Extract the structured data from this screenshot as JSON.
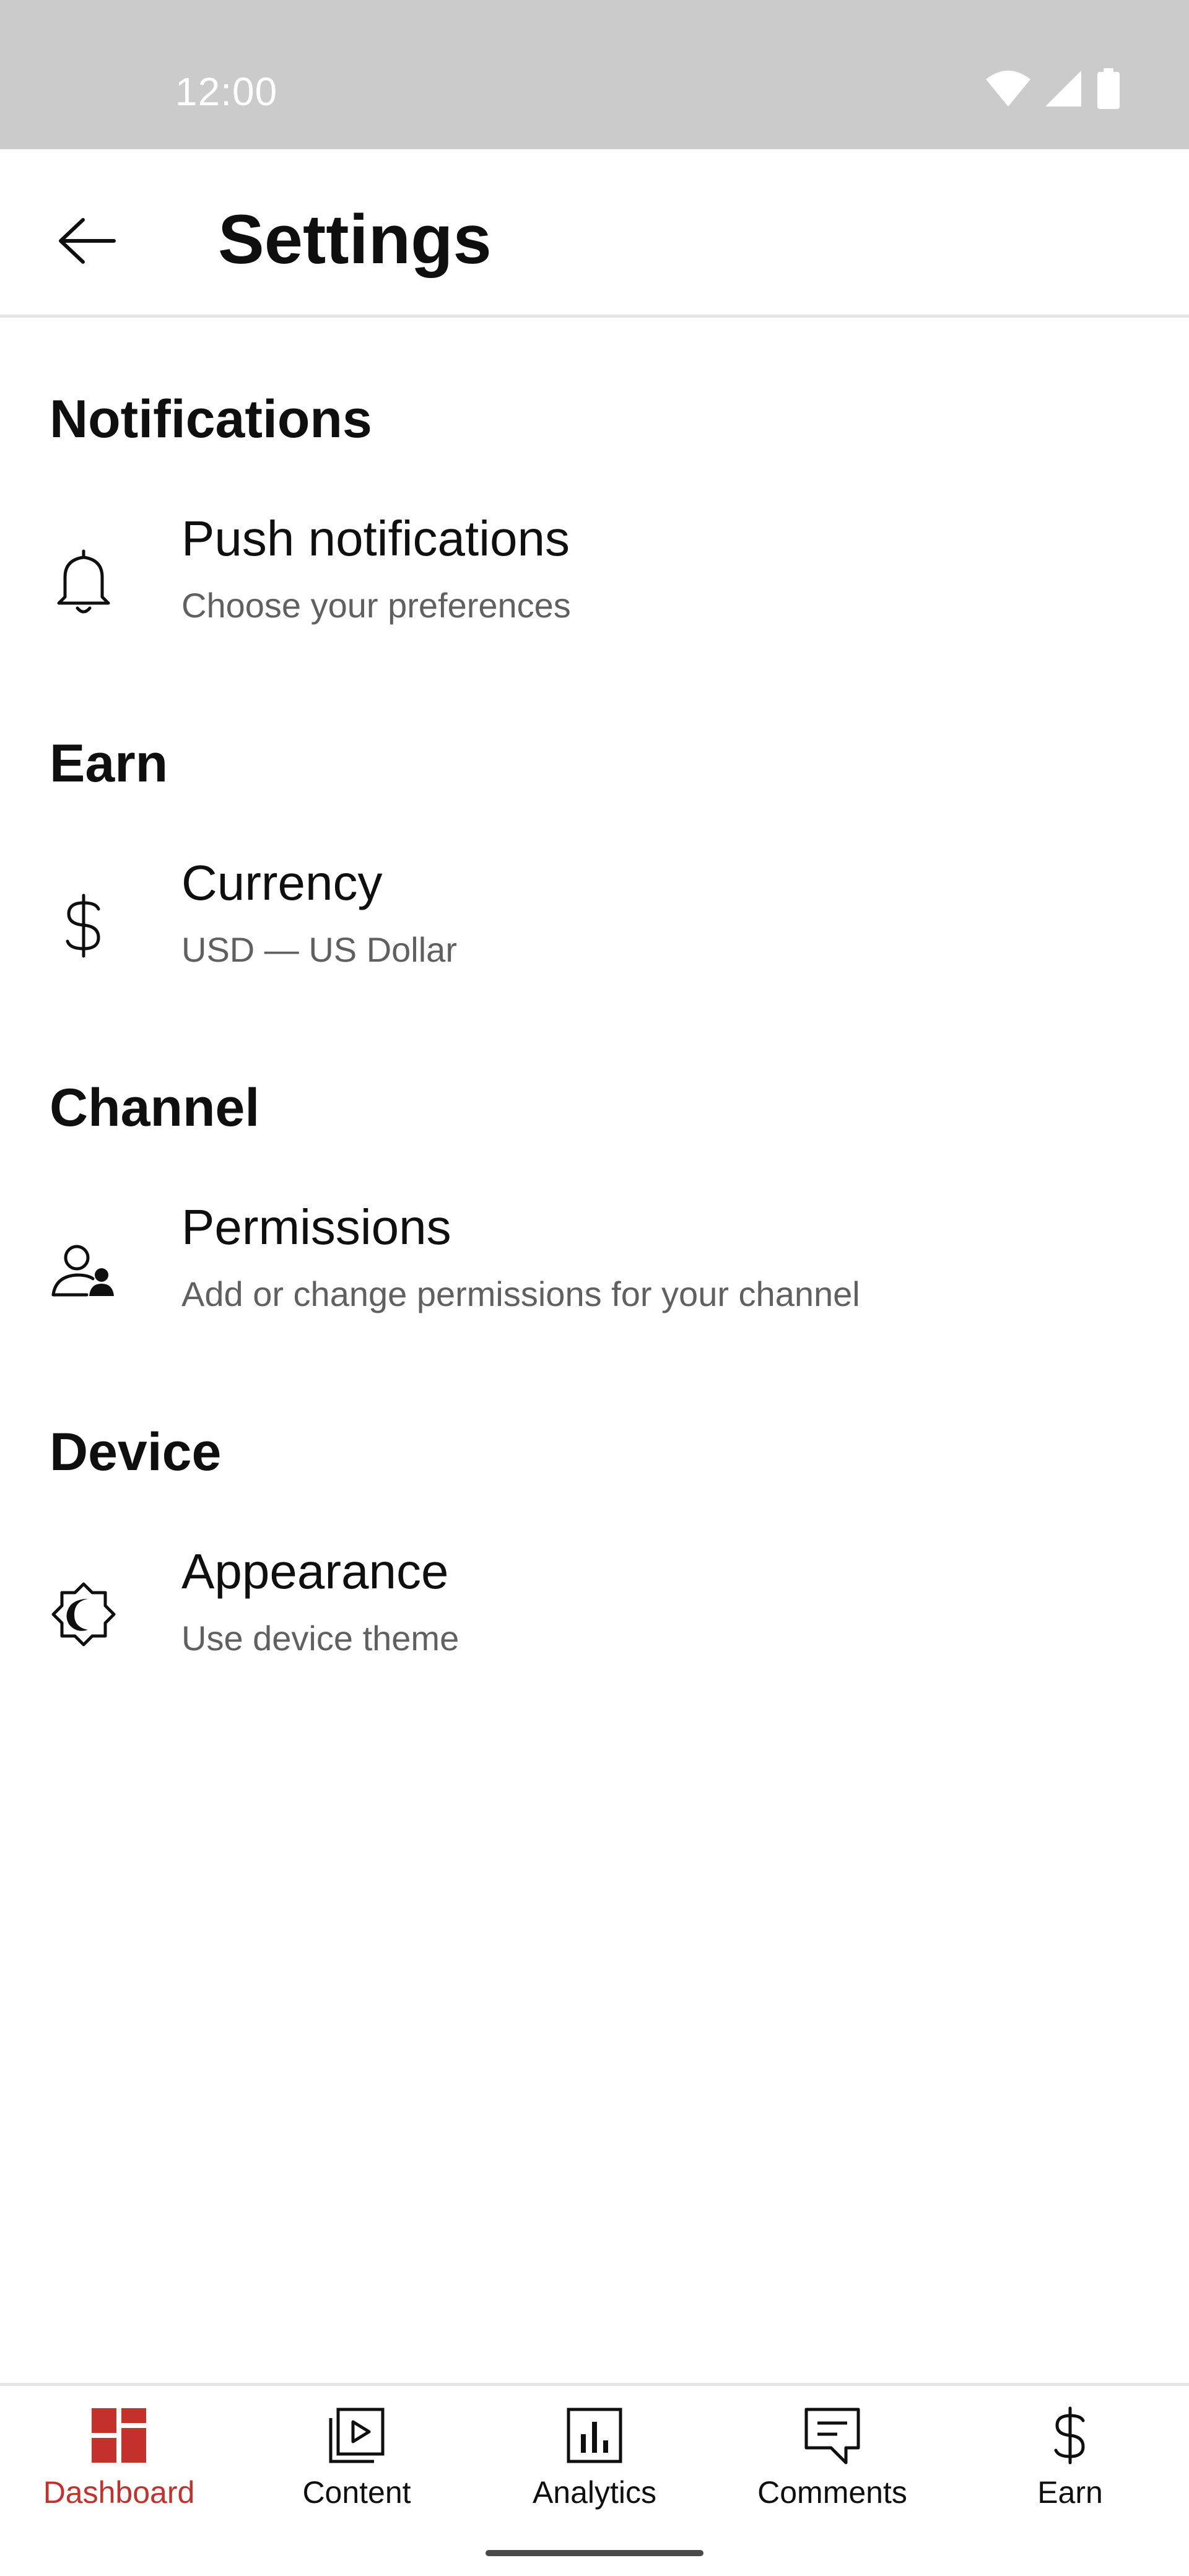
{
  "status_bar": {
    "time": "12:00"
  },
  "header": {
    "title": "Settings",
    "back_icon": "arrow-left-icon"
  },
  "sections": [
    {
      "heading": "Notifications",
      "item": {
        "title": "Push notifications",
        "subtitle": "Choose your preferences",
        "icon": "bell-icon"
      }
    },
    {
      "heading": "Earn",
      "item": {
        "title": "Currency",
        "subtitle": "USD — US Dollar",
        "icon": "dollar-icon"
      }
    },
    {
      "heading": "Channel",
      "item": {
        "title": "Permissions",
        "subtitle": "Add or change permissions for your channel",
        "icon": "person-add-icon"
      }
    },
    {
      "heading": "Device",
      "item": {
        "title": "Appearance",
        "subtitle": "Use device theme",
        "icon": "theme-icon"
      }
    }
  ],
  "bottom_nav": {
    "items": [
      {
        "label": "Dashboard",
        "icon": "dashboard-icon",
        "active": true
      },
      {
        "label": "Content",
        "icon": "video-library-icon",
        "active": false
      },
      {
        "label": "Analytics",
        "icon": "bar-chart-icon",
        "active": false
      },
      {
        "label": "Comments",
        "icon": "comment-icon",
        "active": false
      },
      {
        "label": "Earn",
        "icon": "dollar-icon",
        "active": false
      }
    ]
  },
  "colors": {
    "accent": "#c4302b",
    "status_bar": "#cbcbcb",
    "primary_text": "#0f0f0f",
    "secondary_text": "#606060",
    "divider": "#e5e5e5"
  }
}
